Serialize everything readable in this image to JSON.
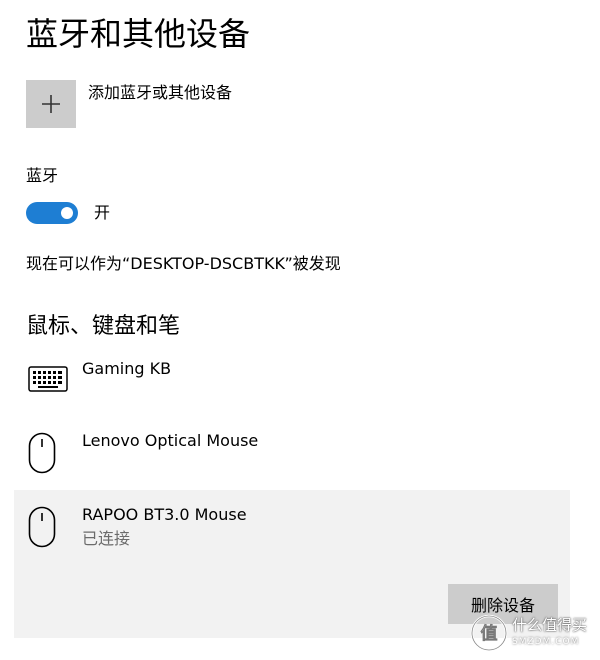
{
  "page": {
    "title": "蓝牙和其他设备"
  },
  "add_device": {
    "icon": "plus-icon",
    "label": "添加蓝牙或其他设备"
  },
  "bluetooth": {
    "label": "蓝牙",
    "toggle_state": "开",
    "toggle_on": true,
    "accent_color": "#1e7ed3",
    "discoverable_text": "现在可以作为“DESKTOP-DSCBTKK”被发现"
  },
  "devices_section": {
    "title": "鼠标、键盘和笔",
    "items": [
      {
        "name": "Gaming KB",
        "icon": "keyboard-icon",
        "status": ""
      },
      {
        "name": "Lenovo Optical Mouse",
        "icon": "mouse-icon",
        "status": ""
      },
      {
        "name": "RAPOO BT3.0 Mouse",
        "icon": "mouse-icon",
        "status": "已连接",
        "selected": true
      }
    ],
    "remove_label": "删除设备"
  },
  "watermark": {
    "text": "什么值得买",
    "sub": "SMZDM.COM"
  }
}
